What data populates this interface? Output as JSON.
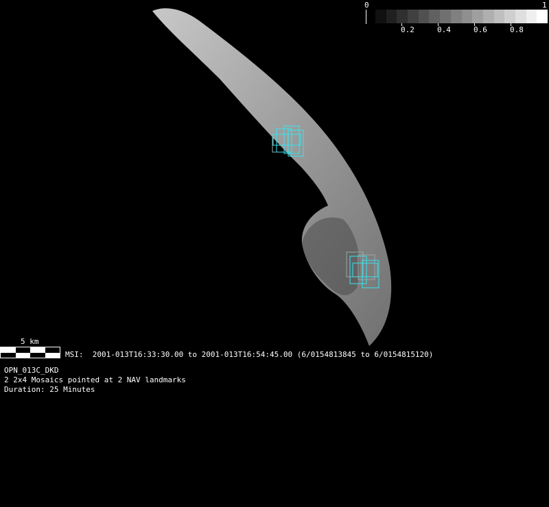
{
  "colorbar": {
    "min_label": "0",
    "max_label": "1",
    "tick_labels": [
      "0.2",
      "0.4",
      "0.6",
      "0.8"
    ],
    "steps": 16
  },
  "scale_bar": {
    "label": "5 km"
  },
  "msi_line": "MSI:  2001-013T16:33:30.00 to 2001-013T16:54:45.00 (6/0154813845 to 6/0154815120)",
  "info": {
    "name": "OPN_013C_DKD",
    "description": "2 2x4 Mosaics pointed at 2 NAV landmarks",
    "duration": "Duration: 25 Minutes"
  },
  "colors": {
    "footprint": "#33e6f0",
    "footprint_alt": "#9aa8a8"
  }
}
